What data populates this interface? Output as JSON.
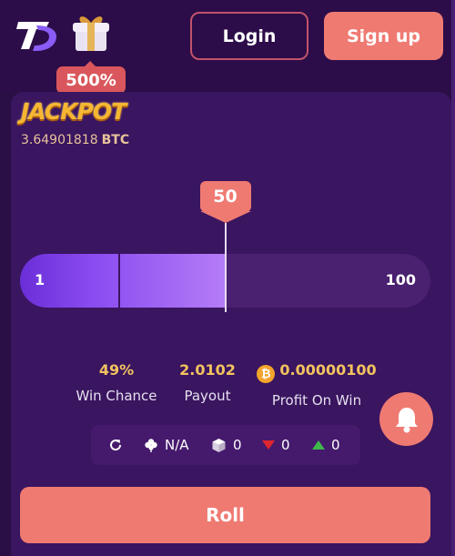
{
  "header": {
    "login_label": "Login",
    "signup_label": "Sign up",
    "bonus_badge": "500%",
    "logo_icon": "tp-logo-icon",
    "gift_icon": "gift-box-icon"
  },
  "jackpot": {
    "title": "JACKPOT",
    "amount": "3.64901818",
    "currency": "BTC"
  },
  "slider": {
    "min_label": "1",
    "max_label": "100",
    "value": "50",
    "fill_percent": 50
  },
  "stats": {
    "win_chance_value": "49%",
    "win_chance_label": "Win Chance",
    "payout_value": "2.0102",
    "payout_label": "Payout",
    "profit_value": "0.00000100",
    "profit_label": "Profit On Win",
    "coin_icon": "bitcoin-icon"
  },
  "info_bar": {
    "refresh_icon": "refresh-icon",
    "clover_icon": "clover-icon",
    "clover_value": "N/A",
    "cube_icon": "cube-icon",
    "cube_value": "0",
    "down_icon": "triangle-down-icon",
    "down_value": "0",
    "up_icon": "triangle-up-icon",
    "up_value": "0"
  },
  "roll_label": "Roll",
  "colors": {
    "background": "#2a0f45",
    "panel": "#3a1560",
    "accent": "#ef7a72",
    "gold": "#f2c35f",
    "slider_fill": "#8a4bf0"
  }
}
